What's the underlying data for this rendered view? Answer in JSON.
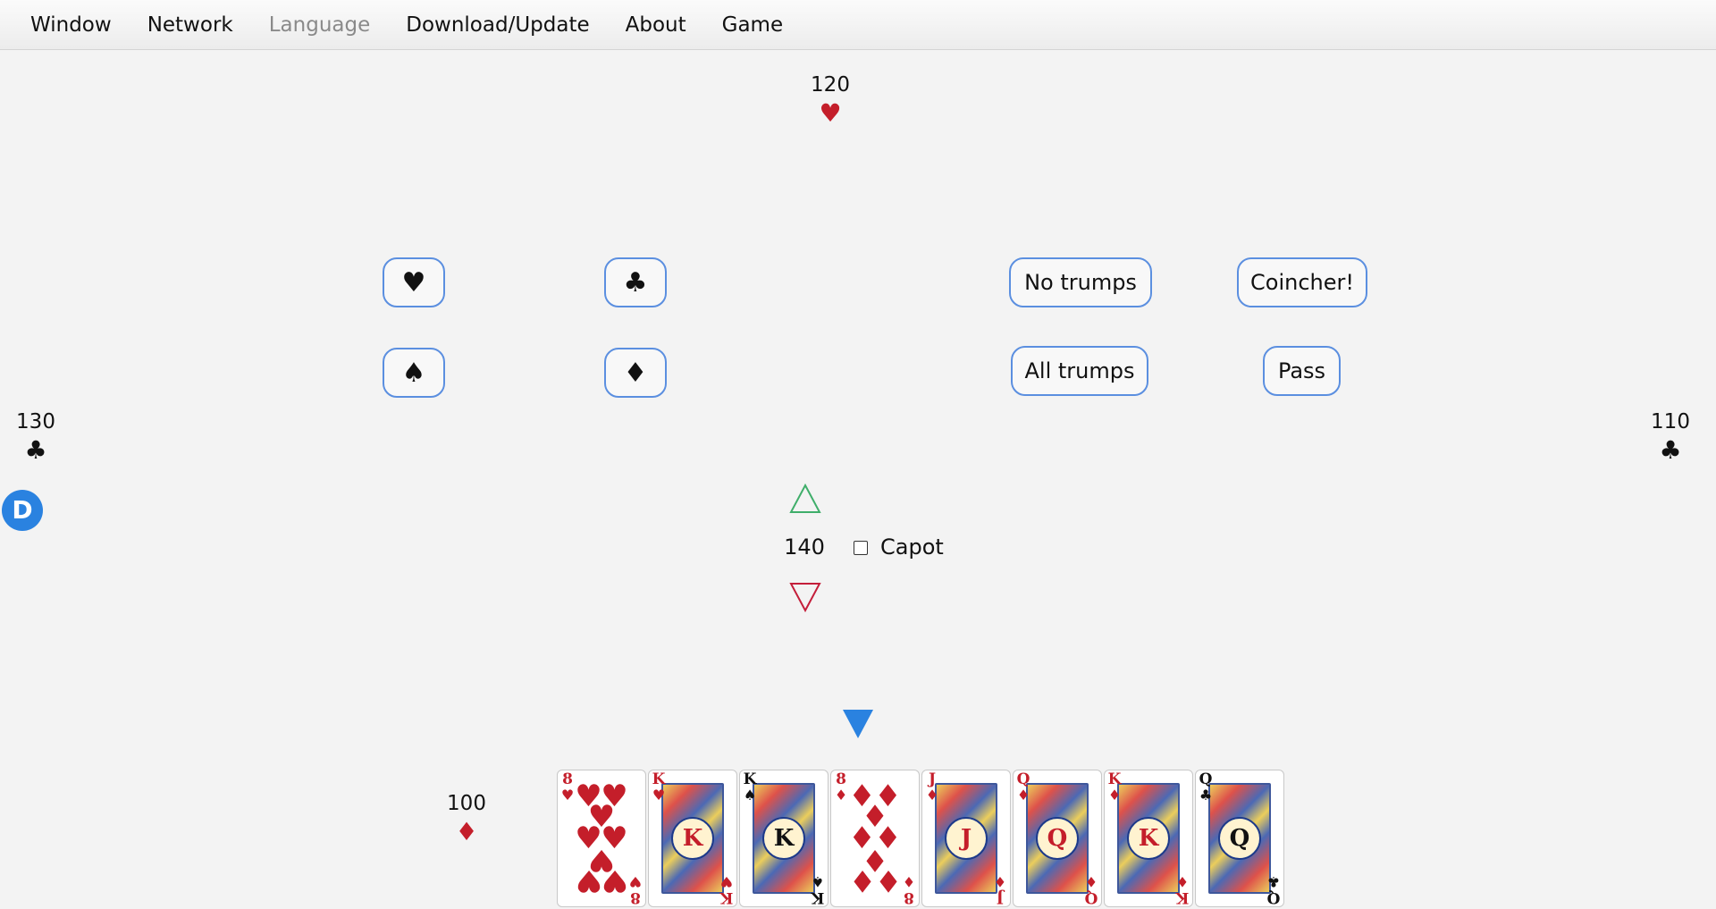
{
  "menu": [
    {
      "label": "Window",
      "enabled": true
    },
    {
      "label": "Network",
      "enabled": true
    },
    {
      "label": "Language",
      "enabled": false
    },
    {
      "label": "Download/Update",
      "enabled": true
    },
    {
      "label": "About",
      "enabled": true
    },
    {
      "label": "Game",
      "enabled": true
    }
  ],
  "players": {
    "north": {
      "bid": "120",
      "suit": "♥",
      "suit_name": "heart-icon",
      "color": "#c41e2a"
    },
    "west": {
      "bid": "130",
      "suit": "♣",
      "suit_name": "club-icon",
      "color": "#111111"
    },
    "east": {
      "bid": "110",
      "suit": "♣",
      "suit_name": "club-icon",
      "color": "#111111"
    },
    "south": {
      "bid": "100",
      "suit": "♦",
      "suit_name": "diamond-icon",
      "color": "#c41e2a"
    }
  },
  "dealer_badge": "D",
  "bid_buttons": {
    "heart": "♥",
    "club": "♣",
    "spade": "♠",
    "diamond": "♦",
    "no_trumps": "No trumps",
    "all_trumps": "All trumps",
    "coincher": "Coincher!",
    "pass": "Pass"
  },
  "bid_selector": {
    "value": "140",
    "capot_label": "Capot",
    "capot_checked": false
  },
  "hand": [
    {
      "rank": "8",
      "suit": "♥",
      "color": "red",
      "type": "pips"
    },
    {
      "rank": "K",
      "suit": "♥",
      "color": "red",
      "type": "face"
    },
    {
      "rank": "K",
      "suit": "♠",
      "color": "black",
      "type": "face"
    },
    {
      "rank": "8",
      "suit": "♦",
      "color": "red",
      "type": "pips"
    },
    {
      "rank": "J",
      "suit": "♦",
      "color": "red",
      "type": "face"
    },
    {
      "rank": "Q",
      "suit": "♦",
      "color": "red",
      "type": "face"
    },
    {
      "rank": "K",
      "suit": "♦",
      "color": "red",
      "type": "face"
    },
    {
      "rank": "Q",
      "suit": "♣",
      "color": "black",
      "type": "face"
    }
  ],
  "colors": {
    "accent": "#2a82e0",
    "button_border": "#5b8fe0",
    "up_arrow": "#3fae6a",
    "down_arrow": "#c41e3a",
    "red_suit": "#c41e2a"
  }
}
